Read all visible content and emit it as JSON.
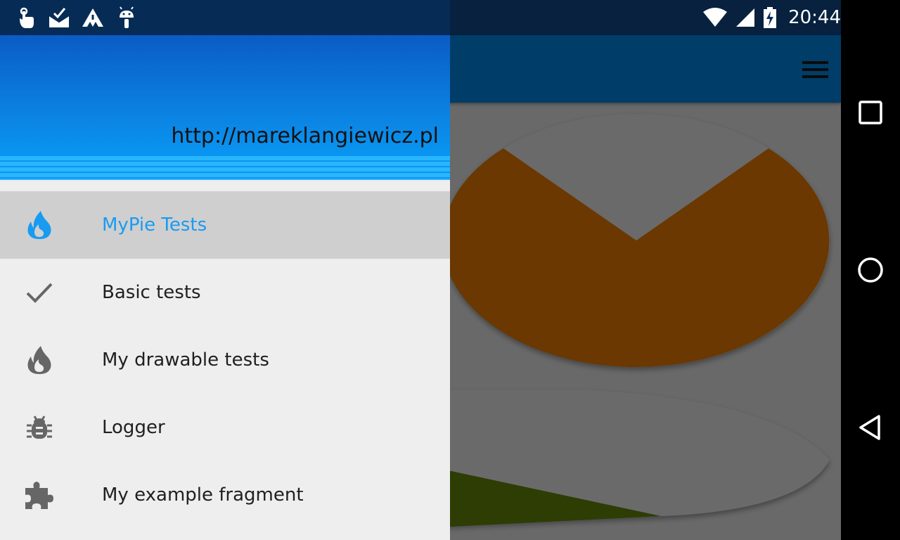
{
  "status_bar": {
    "time": "20:44",
    "left_icons": [
      "touch-gesture-icon",
      "mail-check-icon",
      "warning-triangles-icon",
      "android-icon"
    ],
    "right_icons": [
      "wifi-icon",
      "cell-signal-icon",
      "battery-charging-icon"
    ]
  },
  "drawer": {
    "header_url": "http://mareklangiewicz.pl",
    "items": [
      {
        "label": "MyPie Tests",
        "icon": "flame-icon",
        "selected": true
      },
      {
        "label": "Basic tests",
        "icon": "check-icon",
        "selected": false
      },
      {
        "label": "My drawable tests",
        "icon": "flame-icon",
        "selected": false
      },
      {
        "label": "Logger",
        "icon": "bug-icon",
        "selected": false
      },
      {
        "label": "My example fragment",
        "icon": "puzzle-icon",
        "selected": false
      }
    ]
  },
  "app": {
    "toolbar_icon": "menu-icon",
    "pie_colors": [
      "#6a3800",
      "#6b6b6b",
      "#2d3d04"
    ]
  },
  "navigation_bar": [
    "recents-button",
    "home-button",
    "back-button"
  ],
  "colors": {
    "accent": "#199bf2",
    "header_top": "#0a5cc4",
    "header_bottom": "#0aa0fa",
    "drawer_bg": "#eeeeee",
    "selected_bg": "#cfcfcf"
  }
}
